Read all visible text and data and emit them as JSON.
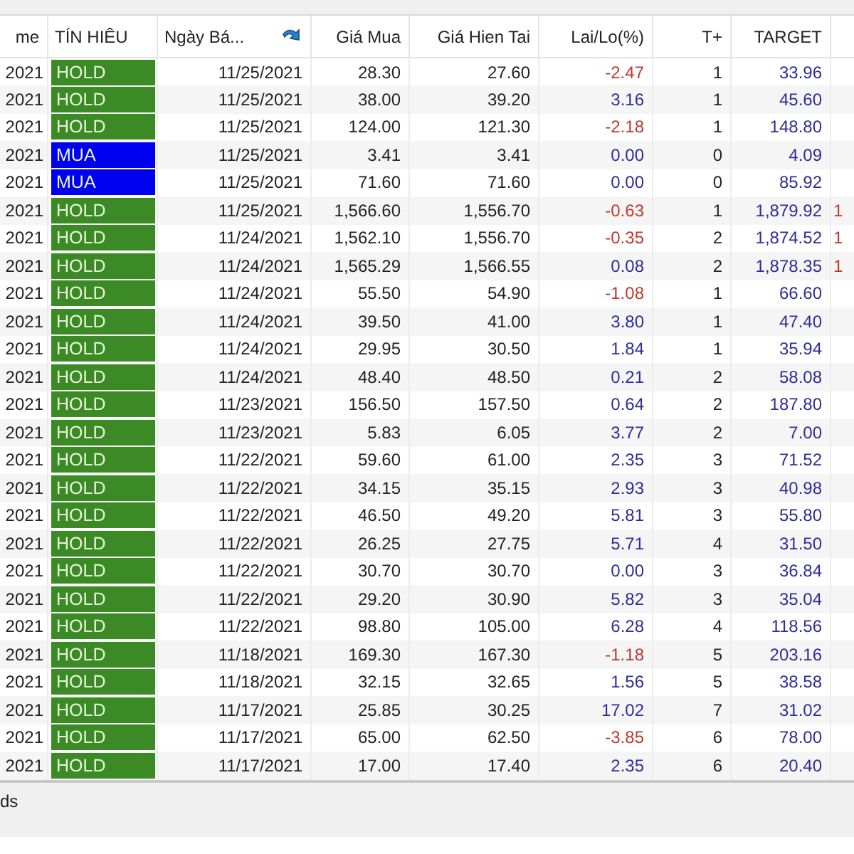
{
  "table": {
    "columns": [
      {
        "label": "me",
        "sorted": false
      },
      {
        "label": "TÍN HIÊU",
        "sorted": false
      },
      {
        "label": "Ngày Bá...",
        "sorted": true
      },
      {
        "label": "Giá Mua",
        "sorted": false
      },
      {
        "label": "Giá Hien Tai",
        "sorted": false
      },
      {
        "label": "Lai/Lo(%)",
        "sorted": false
      },
      {
        "label": "T+",
        "sorted": false
      },
      {
        "label": "TARGET",
        "sorted": false
      }
    ],
    "rows": [
      {
        "column_1": "2021",
        "signal": {
          "text": "HOLD",
          "color": "#3b8a26"
        },
        "date": "11/25/2021",
        "buy": "28.30",
        "now": "27.60",
        "pl": "-2.47",
        "loss": true,
        "t": "1",
        "target": "33.96"
      },
      {
        "column_1": "2021",
        "signal": {
          "text": "HOLD",
          "color": "#3b8a26"
        },
        "date": "11/25/2021",
        "buy": "38.00",
        "now": "39.20",
        "pl": "3.16",
        "loss": false,
        "t": "1",
        "target": "45.60"
      },
      {
        "column_1": "2021",
        "signal": {
          "text": "HOLD",
          "color": "#3b8a26"
        },
        "date": "11/25/2021",
        "buy": "124.00",
        "now": "121.30",
        "pl": "-2.18",
        "loss": true,
        "t": "1",
        "target": "148.80"
      },
      {
        "column_1": "2021",
        "signal": {
          "text": "MUA",
          "color": "#0000f0"
        },
        "date": "11/25/2021",
        "buy": "3.41",
        "now": "3.41",
        "pl": "0.00",
        "loss": false,
        "t": "0",
        "target": "4.09"
      },
      {
        "column_1": "2021",
        "signal": {
          "text": "MUA",
          "color": "#0000f0"
        },
        "date": "11/25/2021",
        "buy": "71.60",
        "now": "71.60",
        "pl": "0.00",
        "loss": false,
        "t": "0",
        "target": "85.92"
      },
      {
        "column_1": "2021",
        "signal": {
          "text": "HOLD",
          "color": "#3b8a26"
        },
        "date": "11/25/2021",
        "buy": "1,566.60",
        "now": "1,556.70",
        "pl": "-0.63",
        "loss": true,
        "t": "1",
        "target": "1,879.92",
        "column_10": "1"
      },
      {
        "column_1": "2021",
        "signal": {
          "text": "HOLD",
          "color": "#3b8a26"
        },
        "date": "11/24/2021",
        "buy": "1,562.10",
        "now": "1,556.70",
        "pl": "-0.35",
        "loss": true,
        "t": "2",
        "target": "1,874.52",
        "column_10": "1"
      },
      {
        "column_1": "2021",
        "signal": {
          "text": "HOLD",
          "color": "#3b8a26"
        },
        "date": "11/24/2021",
        "buy": "1,565.29",
        "now": "1,566.55",
        "pl": "0.08",
        "loss": false,
        "t": "2",
        "target": "1,878.35",
        "column_10": "1"
      },
      {
        "column_1": "2021",
        "signal": {
          "text": "HOLD",
          "color": "#3b8a26"
        },
        "date": "11/24/2021",
        "buy": "55.50",
        "now": "54.90",
        "pl": "-1.08",
        "loss": true,
        "t": "1",
        "target": "66.60"
      },
      {
        "column_1": "2021",
        "signal": {
          "text": "HOLD",
          "color": "#3b8a26"
        },
        "date": "11/24/2021",
        "buy": "39.50",
        "now": "41.00",
        "pl": "3.80",
        "loss": false,
        "t": "1",
        "target": "47.40"
      },
      {
        "column_1": "2021",
        "signal": {
          "text": "HOLD",
          "color": "#3b8a26"
        },
        "date": "11/24/2021",
        "buy": "29.95",
        "now": "30.50",
        "pl": "1.84",
        "loss": false,
        "t": "1",
        "target": "35.94"
      },
      {
        "column_1": "2021",
        "signal": {
          "text": "HOLD",
          "color": "#3b8a26"
        },
        "date": "11/24/2021",
        "buy": "48.40",
        "now": "48.50",
        "pl": "0.21",
        "loss": false,
        "t": "2",
        "target": "58.08"
      },
      {
        "column_1": "2021",
        "signal": {
          "text": "HOLD",
          "color": "#3b8a26"
        },
        "date": "11/23/2021",
        "buy": "156.50",
        "now": "157.50",
        "pl": "0.64",
        "loss": false,
        "t": "2",
        "target": "187.80"
      },
      {
        "column_1": "2021",
        "signal": {
          "text": "HOLD",
          "color": "#3b8a26"
        },
        "date": "11/23/2021",
        "buy": "5.83",
        "now": "6.05",
        "pl": "3.77",
        "loss": false,
        "t": "2",
        "target": "7.00"
      },
      {
        "column_1": "2021",
        "signal": {
          "text": "HOLD",
          "color": "#3b8a26"
        },
        "date": "11/22/2021",
        "buy": "59.60",
        "now": "61.00",
        "pl": "2.35",
        "loss": false,
        "t": "3",
        "target": "71.52"
      },
      {
        "column_1": "2021",
        "signal": {
          "text": "HOLD",
          "color": "#3b8a26"
        },
        "date": "11/22/2021",
        "buy": "34.15",
        "now": "35.15",
        "pl": "2.93",
        "loss": false,
        "t": "3",
        "target": "40.98"
      },
      {
        "column_1": "2021",
        "signal": {
          "text": "HOLD",
          "color": "#3b8a26"
        },
        "date": "11/22/2021",
        "buy": "46.50",
        "now": "49.20",
        "pl": "5.81",
        "loss": false,
        "t": "3",
        "target": "55.80"
      },
      {
        "column_1": "2021",
        "signal": {
          "text": "HOLD",
          "color": "#3b8a26"
        },
        "date": "11/22/2021",
        "buy": "26.25",
        "now": "27.75",
        "pl": "5.71",
        "loss": false,
        "t": "4",
        "target": "31.50"
      },
      {
        "column_1": "2021",
        "signal": {
          "text": "HOLD",
          "color": "#3b8a26"
        },
        "date": "11/22/2021",
        "buy": "30.70",
        "now": "30.70",
        "pl": "0.00",
        "loss": false,
        "t": "3",
        "target": "36.84"
      },
      {
        "column_1": "2021",
        "signal": {
          "text": "HOLD",
          "color": "#3b8a26"
        },
        "date": "11/22/2021",
        "buy": "29.20",
        "now": "30.90",
        "pl": "5.82",
        "loss": false,
        "t": "3",
        "target": "35.04"
      },
      {
        "column_1": "2021",
        "signal": {
          "text": "HOLD",
          "color": "#3b8a26"
        },
        "date": "11/22/2021",
        "buy": "98.80",
        "now": "105.00",
        "pl": "6.28",
        "loss": false,
        "t": "4",
        "target": "118.56"
      },
      {
        "column_1": "2021",
        "signal": {
          "text": "HOLD",
          "color": "#3b8a26"
        },
        "date": "11/18/2021",
        "buy": "169.30",
        "now": "167.30",
        "pl": "-1.18",
        "loss": true,
        "t": "5",
        "target": "203.16"
      },
      {
        "column_1": "2021",
        "signal": {
          "text": "HOLD",
          "color": "#3b8a26"
        },
        "date": "11/18/2021",
        "buy": "32.15",
        "now": "32.65",
        "pl": "1.56",
        "loss": false,
        "t": "5",
        "target": "38.58"
      },
      {
        "column_1": "2021",
        "signal": {
          "text": "HOLD",
          "color": "#3b8a26"
        },
        "date": "11/17/2021",
        "buy": "25.85",
        "now": "30.25",
        "pl": "17.02",
        "loss": false,
        "t": "7",
        "target": "31.02"
      },
      {
        "column_1": "2021",
        "signal": {
          "text": "HOLD",
          "color": "#3b8a26"
        },
        "date": "11/17/2021",
        "buy": "65.00",
        "now": "62.50",
        "pl": "-3.85",
        "loss": true,
        "t": "6",
        "target": "78.00"
      },
      {
        "column_1": "2021",
        "signal": {
          "text": "HOLD",
          "color": "#3b8a26"
        },
        "date": "11/17/2021",
        "buy": "17.00",
        "now": "17.40",
        "pl": "2.35",
        "loss": false,
        "t": "6",
        "target": "20.40"
      }
    ]
  },
  "status_bar": {
    "text": "ds"
  }
}
